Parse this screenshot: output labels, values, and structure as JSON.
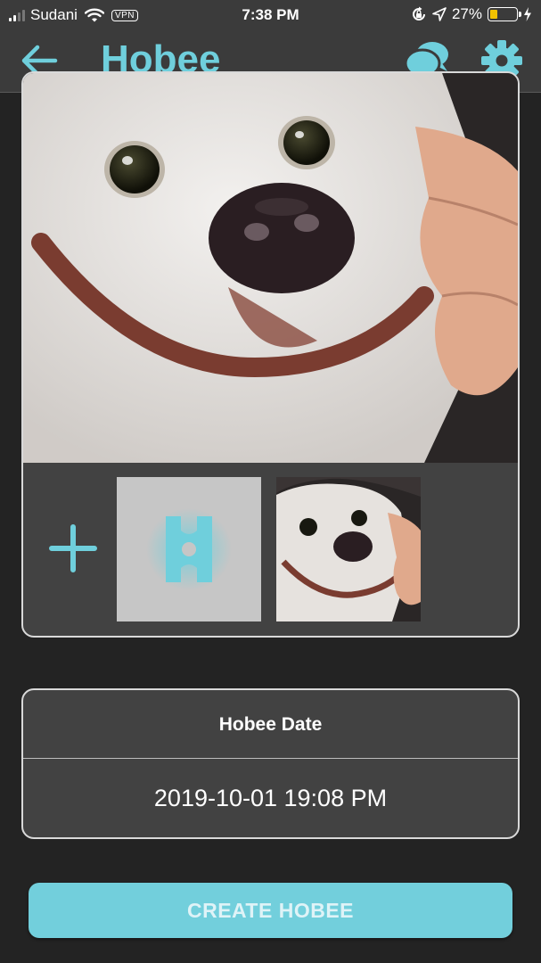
{
  "status_bar": {
    "carrier": "Sudani",
    "vpn": "VPN",
    "time": "7:38 PM",
    "battery": "27%",
    "battery_level": 0.27,
    "icons": [
      "signal-icon",
      "wifi-icon",
      "lock-rotation-icon",
      "location-icon",
      "battery-icon",
      "charging-icon"
    ]
  },
  "header": {
    "title": "Hobee",
    "icons": [
      "back-arrow-icon",
      "chat-bubbles-icon",
      "gear-icon"
    ]
  },
  "photo_card": {
    "icons": [
      "plus-icon",
      "hobee-logo-icon"
    ]
  },
  "date_card": {
    "label": "Hobee Date",
    "value": "2019-10-01 19:08 PM"
  },
  "actions": {
    "create_label": "CREATE HOBEE"
  },
  "colors": {
    "accent": "#6fcfdc",
    "background": "#232323",
    "header": "#3b3b3b",
    "card": "#424242",
    "battery": "#f2c200"
  }
}
